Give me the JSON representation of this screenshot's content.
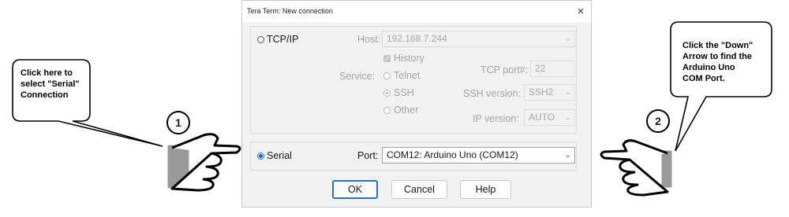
{
  "dialog": {
    "title": "Tera Term: New connection",
    "close_glyph": "×",
    "tcpip": {
      "radio_label": "TCP/IP",
      "host_label": "Host:",
      "host_value": "192.168.7.244",
      "history_label": "History",
      "service_label": "Service:",
      "telnet_label": "Telnet",
      "ssh_label": "SSH",
      "other_label": "Other",
      "tcp_port_label": "TCP port#:",
      "tcp_port_value": "22",
      "ssh_version_label": "SSH version:",
      "ssh_version_value": "SSH2",
      "ip_version_label": "IP version:",
      "ip_version_value": "AUTO"
    },
    "serial": {
      "radio_label": "Serial",
      "port_label": "Port:",
      "port_value": "COM12: Arduino Uno (COM12)"
    },
    "buttons": {
      "ok": "OK",
      "cancel": "Cancel",
      "help": "Help"
    }
  },
  "callouts": {
    "left": {
      "number": "1",
      "lines": [
        "Click here to",
        "select \"Serial\"",
        "Connection"
      ]
    },
    "right": {
      "number": "2",
      "lines": [
        "Click the \"Down\"",
        "Arrow to find the",
        "Arduino Uno",
        "COM Port."
      ]
    }
  },
  "colors": {
    "accent": "#1f5fbf",
    "disabled_text": "#a6a6a6",
    "dialog_bg": "#f2f2f2"
  }
}
